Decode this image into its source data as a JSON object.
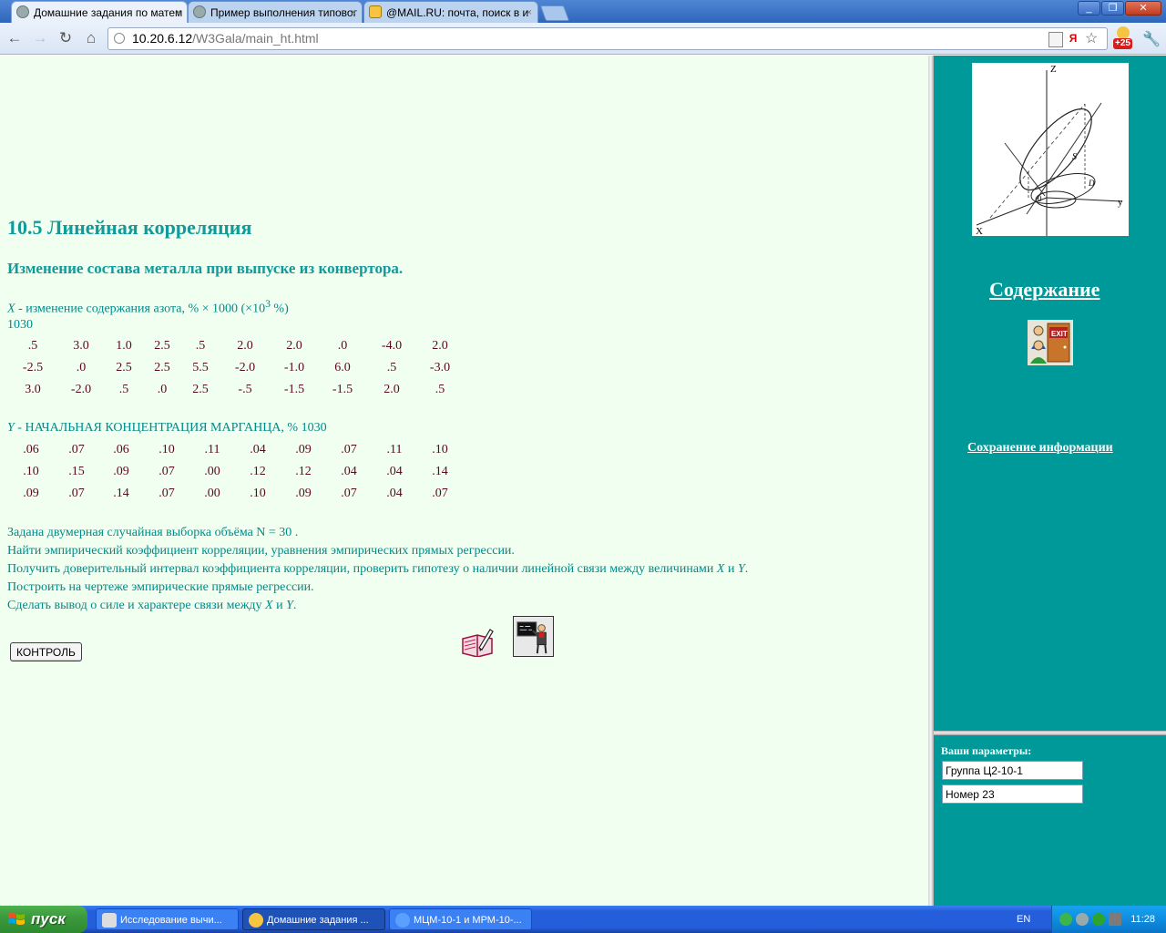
{
  "browser": {
    "tabs": [
      {
        "title": "Домашние задания по матем",
        "close": "×"
      },
      {
        "title": "Пример выполнения типовог",
        "close": "×"
      },
      {
        "title": "@MAIL.RU: почта, поиск в и",
        "close": "×"
      }
    ],
    "window_controls": {
      "minimize": "_",
      "maximize": "❐",
      "close": "✕"
    },
    "nav": {
      "back": "←",
      "forward": "→",
      "reload": "↻",
      "home": "⌂"
    },
    "url_host": "10.20.6.12",
    "url_path": "/W3Gala/main_ht.html",
    "extension_badge": "+25",
    "wrench": "🔧"
  },
  "content": {
    "heading": "10.5 Линейная корреляция",
    "subheading": "Изменение состава металла при выпуске из конвертора.",
    "x_desc": {
      "var": "X",
      "text": " - изменение содержания азота, % × 1000 (×10",
      "sup": "3",
      "tail": " %)"
    },
    "x_extra": "1030",
    "x_values": [
      [
        ".5",
        "3.0",
        "1.0",
        "2.5",
        ".5",
        "2.0",
        "2.0",
        ".0",
        "-4.0",
        "2.0"
      ],
      [
        "-2.5",
        ".0",
        "2.5",
        "2.5",
        "5.5",
        "-2.0",
        "-1.0",
        "6.0",
        ".5",
        "-3.0"
      ],
      [
        "3.0",
        "-2.0",
        ".5",
        ".0",
        "2.5",
        "-.5",
        "-1.5",
        "-1.5",
        "2.0",
        ".5"
      ]
    ],
    "y_desc": {
      "var": "Y",
      "text": " - НАЧАЛЬНАЯ КОНЦЕНТРАЦИЯ МАРГАНЦА, % 1030"
    },
    "y_values": [
      [
        ".06",
        ".07",
        ".06",
        ".10",
        ".11",
        ".04",
        ".09",
        ".07",
        ".11",
        ".10"
      ],
      [
        ".10",
        ".15",
        ".09",
        ".07",
        ".00",
        ".12",
        ".12",
        ".04",
        ".04",
        ".14"
      ],
      [
        ".09",
        ".07",
        ".14",
        ".07",
        ".00",
        ".10",
        ".09",
        ".07",
        ".04",
        ".07"
      ]
    ],
    "task_line1": "Задана двумерная случайная выборка объёма N = 30 .",
    "task_line2": "Найти эмпирический коэффициент корреляции, уравнения эмпирических прямых регрессии.",
    "task_line3_a": "Получить доверительный интервал коэффициента корреляции, проверить гипотезу о наличии линейной связи между величинами ",
    "task_line3_x": "X",
    "task_line3_and": " и ",
    "task_line3_y": "Y",
    "task_line3_end": ".",
    "task_line4": "Построить на чертеже эмпирические прямые регрессии.",
    "task_line5_a": "Сделать вывод о силе и характере связи между ",
    "task_line5_x": "X",
    "task_line5_and": " и ",
    "task_line5_y": "Y",
    "task_line5_end": ".",
    "control_button": "КОНТРОЛЬ"
  },
  "sidebar": {
    "contents_link": "Содержание",
    "save_link": "Сохранение информации",
    "exit_label": "EXIT",
    "diagram_labels": {
      "z": "Z",
      "y": "y",
      "x": "X",
      "o": "0",
      "s": "S",
      "d": "D"
    },
    "params_label": "Ваши параметры:",
    "group_field": "Группа Ц2-10-1",
    "number_field": "Номер 23"
  },
  "taskbar": {
    "start": "пуск",
    "tasks": [
      "Исследование вычи...",
      "Домашние задания ...",
      "МЦМ-10-1 и МРМ-10-..."
    ],
    "lang": "EN",
    "clock": "11:28"
  }
}
